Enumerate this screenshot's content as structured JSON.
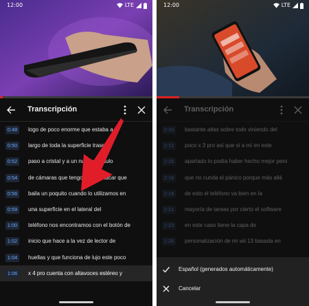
{
  "status_bar": {
    "time": "12:00",
    "network": "LTE"
  },
  "transcript_panel": {
    "title": "Transcripción"
  },
  "left_screen": {
    "progress_fraction": 0.02,
    "rows": [
      {
        "time": "0:48",
        "text": "logo de poco enorme que estaba a lo"
      },
      {
        "time": "0:50",
        "text": "largo de toda la superficie trasera"
      },
      {
        "time": "0:52",
        "text": "paso a cristal y a un nuevo módulo"
      },
      {
        "time": "0:54",
        "text": "de cámaras que tengo que destacar que"
      },
      {
        "time": "0:56",
        "text": "baila un poquito cuando lo utilizamos en"
      },
      {
        "time": "0:59",
        "text": "una superficie en el lateral del"
      },
      {
        "time": "1:00",
        "text": "teléfono nos encontramos con el botón de"
      },
      {
        "time": "1:02",
        "text": "inicio que hace a la vez de lector de"
      },
      {
        "time": "1:04",
        "text": "huellas y que funciona de lujo este poco"
      },
      {
        "time": "1:06",
        "text": "x 4 pro cuenta con altavoces estéreo y"
      }
    ]
  },
  "right_screen": {
    "progress_fraction": 0.15,
    "rows": [
      {
        "time": "2:10",
        "text": "bastante altas sobre todo viniendo del"
      },
      {
        "time": "2:12",
        "text": "poco x 3 pro así que si a mí en este"
      },
      {
        "time": "2:15",
        "text": "apartado lo podía haber hecho mejor pero"
      },
      {
        "time": "2:16",
        "text": "que no cunda el pánico porque más allá"
      },
      {
        "time": "2:18",
        "text": "de esto el teléfono va bien en la"
      },
      {
        "time": "2:21",
        "text": "mayoría de tareas por cierto el software"
      },
      {
        "time": "2:23",
        "text": "en este caso tiene la capa de"
      },
      {
        "time": "2:26",
        "text": "personalización de mi wii 13 basada en"
      }
    ],
    "menu": {
      "language_option": "Español (generados automáticamente)",
      "cancel_option": "Cancelar"
    }
  },
  "colors": {
    "accent": "#e02020",
    "timestamp_text": "#6ea8fe",
    "arrow": "#e11d2a"
  }
}
